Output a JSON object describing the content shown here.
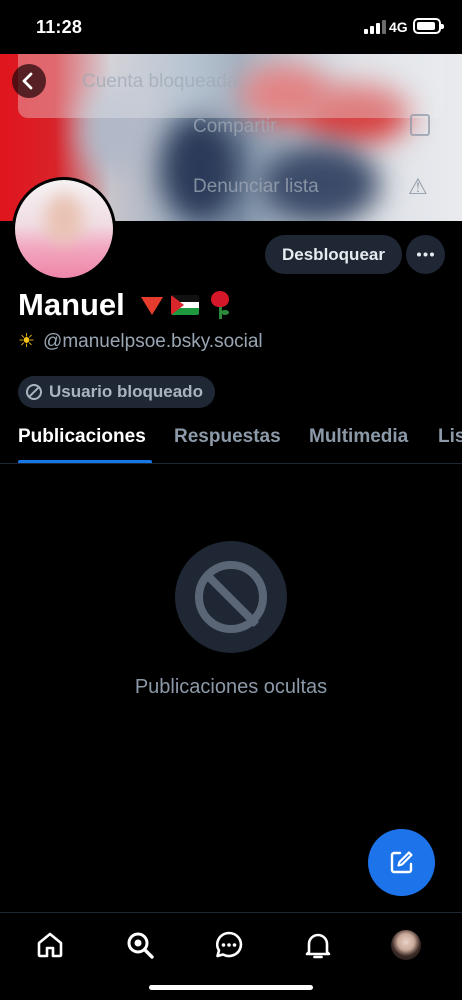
{
  "status_bar": {
    "time": "11:28",
    "network": "4G"
  },
  "header_menu": {
    "title": "Cuenta bloqueada",
    "share_label": "Compartir",
    "report_label": "Denunciar lista"
  },
  "profile": {
    "name": "Manuel",
    "handle": "@manuelpsoe.bsky.social",
    "unblock_label": "Desbloquear",
    "blocked_badge": "Usuario bloqueado"
  },
  "tabs": [
    {
      "label": "Publicaciones",
      "active": true
    },
    {
      "label": "Respuestas",
      "active": false
    },
    {
      "label": "Multimedia",
      "active": false
    },
    {
      "label": "Lis",
      "active": false
    }
  ],
  "content": {
    "hidden_posts_text": "Publicaciones ocultas"
  },
  "bottom_nav": [
    "home-icon",
    "search-icon",
    "chat-icon",
    "bell-icon",
    "profile-avatar"
  ],
  "colors": {
    "accent": "#1677e8",
    "fab": "#1d73ea",
    "surface": "#1e2733",
    "muted_text": "#8c99a8"
  }
}
